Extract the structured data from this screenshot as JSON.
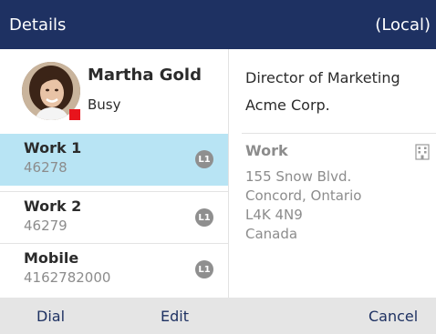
{
  "header": {
    "title": "Details",
    "scope": "(Local)"
  },
  "contact": {
    "name": "Martha Gold",
    "status": "Busy",
    "presence_color": "#e8141c"
  },
  "lines": [
    {
      "label": "Work 1",
      "number": "46278",
      "badge": "L1",
      "selected": true
    },
    {
      "label": "Work 2",
      "number": "46279",
      "badge": "L1",
      "selected": false
    },
    {
      "label": "Mobile",
      "number": "4162782000",
      "badge": "L1",
      "selected": false
    }
  ],
  "details": {
    "job_title": "Director of Marketing",
    "company": "Acme Corp.",
    "address_label": "Work",
    "address_icon": "building-icon",
    "address_lines": [
      "155 Snow Blvd.",
      "Concord, Ontario",
      "L4K 4N9",
      "Canada"
    ]
  },
  "softkeys": {
    "dial": "Dial",
    "edit": "Edit",
    "cancel": "Cancel"
  },
  "colors": {
    "header_bg": "#1e3162",
    "selected_bg": "#b8e4f4",
    "softkey_text": "#1e3162"
  }
}
